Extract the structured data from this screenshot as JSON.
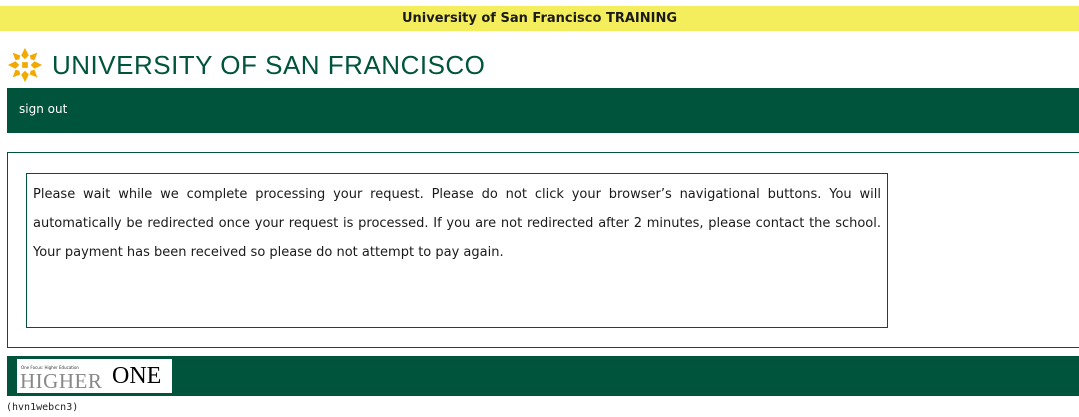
{
  "banner": {
    "text": "University of San Francisco TRAINING"
  },
  "logo": {
    "text": "UNIVERSITY OF SAN FRANCISCO",
    "icon": "usf-logo-icon"
  },
  "nav": {
    "sign_out": "sign out"
  },
  "message": {
    "text": "Please wait while we complete processing your request. Please do not click your browser’s navigational buttons. You will automatically be redirected once your request is processed. If you are not redirected after 2 minutes, please contact the school. Your payment has been received so please do not attempt to pay again."
  },
  "footer": {
    "logo_tagline": "One Focus: Higher Education",
    "logo_higher": "HIGHER",
    "logo_one": "ONE"
  },
  "server_id": "(hvn1webcn3)",
  "colors": {
    "brand_green": "#00543c",
    "banner_yellow": "#f4ee5c",
    "logo_gold": "#f2a900"
  }
}
